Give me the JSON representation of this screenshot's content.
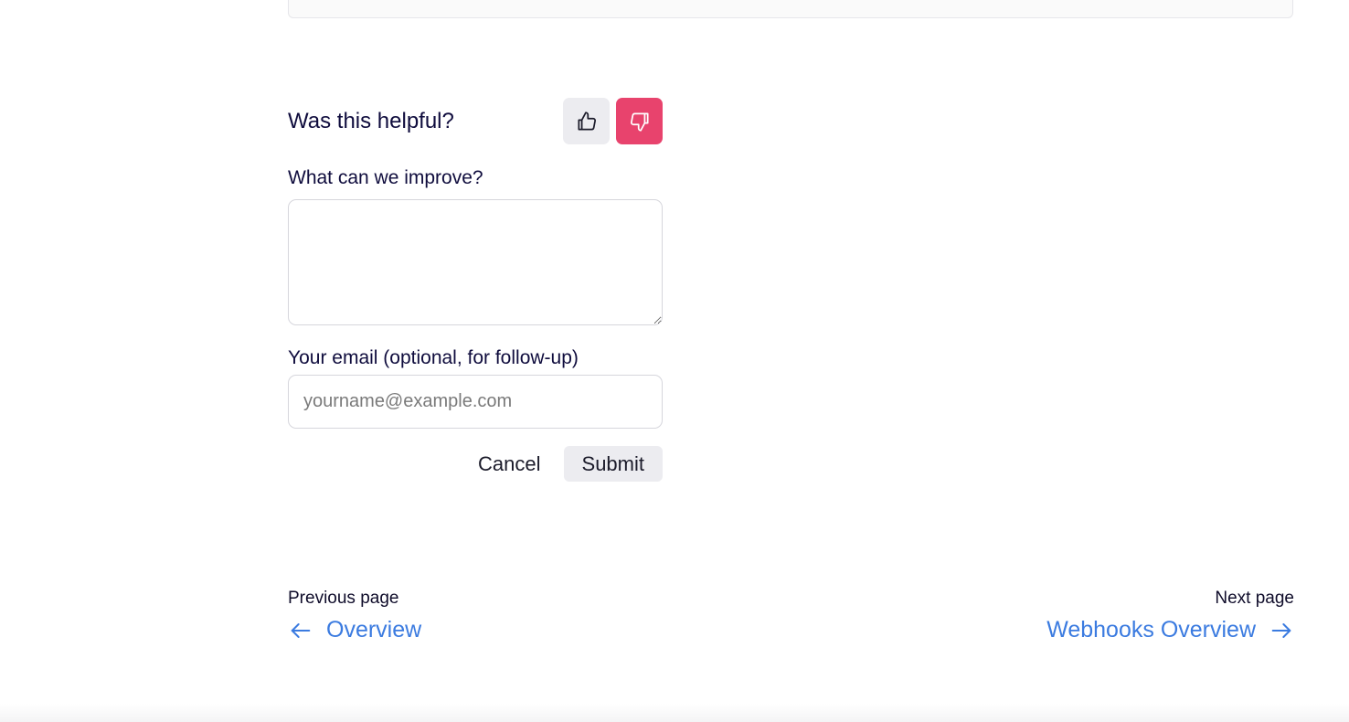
{
  "feedback": {
    "question": "Was this helpful?",
    "thumbs_up_icon": "thumbs-up-icon",
    "thumbs_down_icon": "thumbs-down-icon",
    "thumbs_down_active_color": "#e8436d",
    "improve_label": "What can we improve?",
    "improve_value": "",
    "email_label": "Your email (optional, for follow-up)",
    "email_placeholder": "yourname@example.com",
    "email_value": "",
    "cancel_label": "Cancel",
    "submit_label": "Submit"
  },
  "pagination": {
    "previous_caption": "Previous page",
    "previous_title": "Overview",
    "previous_icon": "arrow-left-icon",
    "next_caption": "Next page",
    "next_title": "Webhooks Overview",
    "next_icon": "arrow-right-icon",
    "link_color": "#3b7be0"
  }
}
